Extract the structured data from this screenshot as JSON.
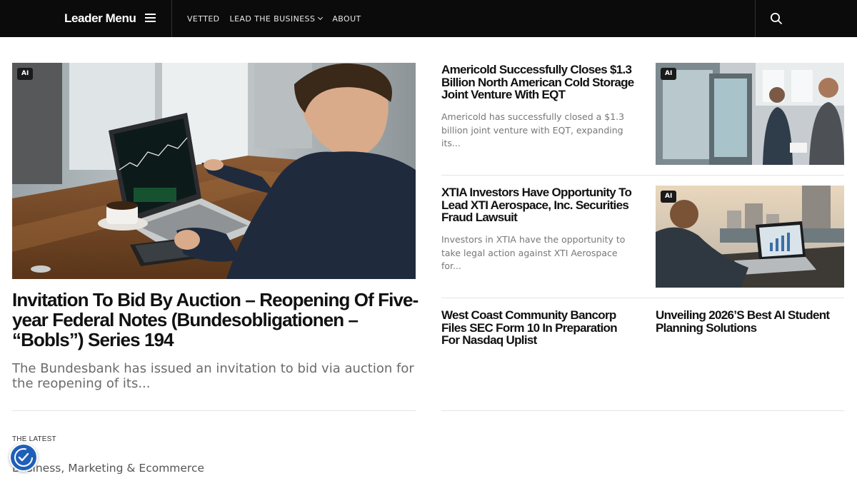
{
  "header": {
    "brand": "Leader Menu",
    "nav": [
      {
        "label": "VETTED"
      },
      {
        "label": "LEAD THE BUSINESS"
      },
      {
        "label": "ABOUT"
      }
    ]
  },
  "hero": {
    "badge": "AI",
    "title": "Invitation To Bid By Auction – Reopening Of Five-year Federal Notes (Bundesobligationen – “Bobls”) Series 194",
    "excerpt": "The Bundesbank has issued an invitation to bid via auction for the reopening of its..."
  },
  "articles": [
    {
      "title": "Americold Successfully Closes $1.3 Billion North American Cold Storage Joint Venture With EQT",
      "excerpt": "Americold has successfully closed a $1.3 billion joint venture with EQT, expanding its...",
      "badge": "AI"
    },
    {
      "title": "XTIA Investors Have Opportunity To Lead XTI Aerospace, Inc. Securities Fraud Lawsuit",
      "excerpt": "Investors in XTIA have the opportunity to take legal action against XTI Aerospace for...",
      "badge": "AI"
    },
    {
      "title": "West Coast Community Bancorp Files SEC Form 10 In Preparation For Nasdaq Uplist"
    },
    {
      "title": "Unveiling 2026’S Best AI Student Planning Solutions"
    }
  ],
  "latest": {
    "label": "THE LATEST",
    "categories": "Business, Marketing & Ecommerce"
  },
  "icons": {
    "menu": "hamburger-menu-icon",
    "search": "search-icon",
    "dropdown": "chevron-down-icon",
    "accessibility": "accessibility-icon"
  },
  "colors": {
    "header_bg": "#0b0b0b",
    "badge_bg": "#1a1a1a",
    "accessibility_bg": "#1f5fb8"
  }
}
